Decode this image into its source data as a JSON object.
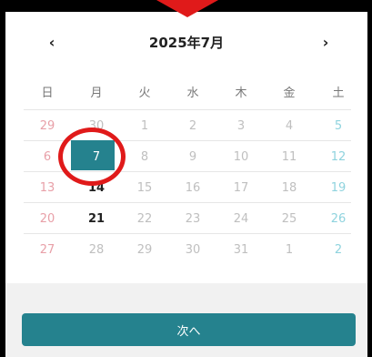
{
  "calendar": {
    "title": "2025年7月",
    "prev_icon": "‹",
    "next_icon": "›",
    "weekdays": [
      "日",
      "月",
      "火",
      "水",
      "木",
      "金",
      "土"
    ],
    "weeks": [
      [
        "29",
        "30",
        "1",
        "2",
        "3",
        "4",
        "5"
      ],
      [
        "6",
        "7",
        "8",
        "9",
        "10",
        "11",
        "12"
      ],
      [
        "13",
        "14",
        "15",
        "16",
        "17",
        "18",
        "19"
      ],
      [
        "20",
        "21",
        "22",
        "23",
        "24",
        "25",
        "26"
      ],
      [
        "27",
        "28",
        "29",
        "30",
        "31",
        "1",
        "2"
      ]
    ],
    "selected_day": "7"
  },
  "footer": {
    "next_label": "次へ"
  },
  "colors": {
    "accent": "#25828e",
    "sunday": "#e8a0a8",
    "saturday": "#8fd3de",
    "highlight": "#e01a1a"
  },
  "icons": {
    "prev": "chevron-left-icon",
    "next": "chevron-right-icon",
    "pointer": "down-arrow-icon"
  }
}
